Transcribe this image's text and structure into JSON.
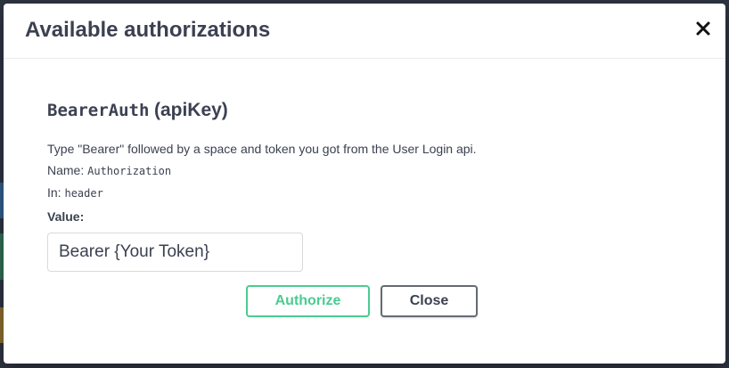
{
  "modal": {
    "title": "Available authorizations",
    "close_icon": "close-icon"
  },
  "auth": {
    "scheme_name": "BearerAuth",
    "scheme_type": "(apiKey)",
    "description": "Type \"Bearer\" followed by a space and token you got from the User Login api.",
    "name_label": "Name:",
    "name_value": "Authorization",
    "in_label": "In:",
    "in_value": "header",
    "value_label": "Value:",
    "value_input": "Bearer {Your Token}"
  },
  "buttons": {
    "authorize_label": "Authorize",
    "close_label": "Close"
  },
  "colors": {
    "text": "#3b4151",
    "authorize_green": "#49cc90",
    "close_border": "#666a73",
    "backdrop": "#2e3340"
  }
}
